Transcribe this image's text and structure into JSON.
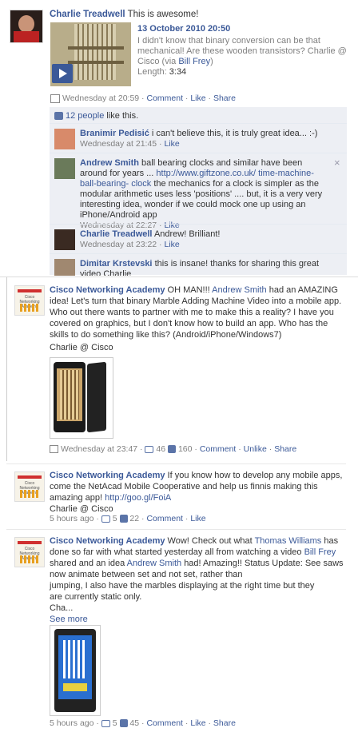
{
  "post1": {
    "author": "Charlie Treadwell",
    "message": "This is awesome!",
    "video": {
      "title": "13 October 2010 20:50",
      "desc": "I didn't know that binary conversion can be that mechanical! Are these wooden transistors? Charlie @ Cisco (via ",
      "via_link": "Bill Frey",
      "desc_end": ")",
      "length_label": "Length:",
      "length": "3:34"
    },
    "time": "Wednesday at 20:59",
    "comment_label": "Comment",
    "like_label": "Like",
    "share_label": "Share",
    "likes_text": "12 people",
    "likes_suffix": "like this.",
    "comments": [
      {
        "author": "Branimir Pedisić",
        "text": "i can't believe this, it is truly great idea... :-)",
        "time": "Wednesday at 21:45",
        "like": "Like"
      },
      {
        "author": "Andrew Smith",
        "text1": "ball bearing clocks and similar have been around for years ...",
        "link": "http://www.giftzone.co.uk/ time-machine-ball-bearing- clock",
        "text2": "the mechanics for a clock is simpler as the modular arithmetic uses less 'positions' .... but, it is a very very interesting idea, wonder if we could mock one up using an iPhone/Android app",
        "time": "Wednesday at 22:27",
        "like": "Like",
        "close": "×"
      },
      {
        "author": "Charlie Treadwell",
        "text": "Andrew! Brilliant!",
        "time": "Wednesday at 23:22",
        "like": "Like"
      },
      {
        "author": "Dimitar Krstevski",
        "text": "this is insane! thanks for sharing this great video Charlie"
      }
    ]
  },
  "post2": {
    "author": "Cisco Networking Academy",
    "msg_a": "OH MAN!!!",
    "mention": "Andrew Smith",
    "msg_b": "had an AMAZING idea! Let's turn that binary Marble Adding Machine Video into a mobile app. Who out there wants to partner with me to make this a reality? I have you covered on graphics, but I don't know how to build an app. Who has the skills to do something like this? (Android/iPhone/Windows7)",
    "signature": "Charlie @ Cisco",
    "time": "Wednesday at 23:47",
    "comments_count": "46",
    "likes_count": "160",
    "comment_label": "Comment",
    "unlike_label": "Unlike",
    "share_label": "Share"
  },
  "post3": {
    "author": "Cisco Networking Academy",
    "msg": "If you know how to develop any mobile apps, come the NetAcad Mobile Cooperative and help us finnis making this amazing app!",
    "link": "http://goo.gl/FoiA",
    "signature": "Charlie @ Cisco",
    "time": "5 hours ago",
    "comments_count": "5",
    "likes_count": "22",
    "comment_label": "Comment",
    "like_label": "Like"
  },
  "post4": {
    "author": "Cisco Networking Academy",
    "msg_a": "Wow! Check out what",
    "mention1": "Thomas Williams",
    "msg_b": "has done so far with what started yesterday all from watching a video",
    "mention2": "Bill Frey",
    "msg_c": "shared and an idea",
    "mention3": "Andrew Smith",
    "msg_d": "had! Amazing!! Status Update: See saws now animate between set and not set, rather than",
    "msg_e": "jumping, I also have the marbles displaying at the right time but they",
    "msg_f": "are currently static only.",
    "msg_g": "Cha...",
    "see_more": "See more",
    "time": "5 hours ago",
    "comments_count": "5",
    "likes_count": "45",
    "comment_label": "Comment",
    "like_label": "Like",
    "share_label": "Share"
  },
  "colors": {
    "link": "#3b5998",
    "comment_bg": "#edeff4",
    "meta": "#808080"
  }
}
